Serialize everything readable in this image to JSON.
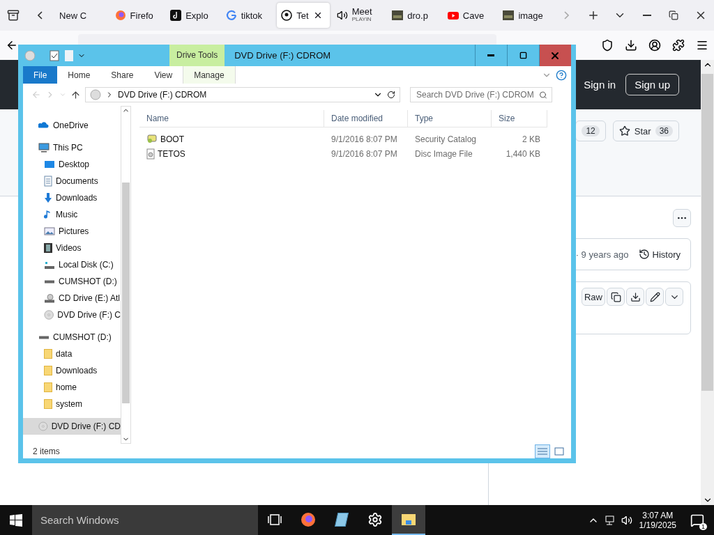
{
  "browser": {
    "tabs": [
      {
        "label": "New C",
        "kind": "none",
        "selected": false
      },
      {
        "label": "Firefo",
        "kind": "firefox",
        "selected": false
      },
      {
        "label": "Explo",
        "kind": "tiktok",
        "selected": false
      },
      {
        "label": "tiktok",
        "kind": "google",
        "selected": false
      },
      {
        "label": "Tet",
        "kind": "github",
        "selected": true
      },
      {
        "label": "Meet",
        "sublabel": "PLAYIN",
        "kind": "speaker",
        "selected": false
      },
      {
        "label": "dro.p",
        "kind": "thumb",
        "selected": false
      },
      {
        "label": "Cave",
        "kind": "youtube",
        "selected": false
      },
      {
        "label": "image",
        "kind": "thumb",
        "selected": false
      }
    ]
  },
  "page": {
    "sign_in": "Sign in",
    "sign_up": "Sign up",
    "fork_count": "12",
    "star_label": "Star",
    "star_count": "36",
    "commit_info": "· 9 years ago",
    "history": "History",
    "raw": "Raw"
  },
  "explorer": {
    "title": "DVD Drive (F:) CDROM",
    "context_tab": "Drive Tools",
    "ribbon_tabs": [
      {
        "label": "File",
        "kind": "file"
      },
      {
        "label": "Home",
        "kind": "tab"
      },
      {
        "label": "Share",
        "kind": "tab"
      },
      {
        "label": "View",
        "kind": "tab"
      },
      {
        "label": "Manage",
        "kind": "context"
      }
    ],
    "address": "DVD Drive (F:) CDROM",
    "search": {
      "placeholder": "Search DVD Drive (F:) CDROM"
    },
    "tree": [
      {
        "label": "OneDrive",
        "kind": "onedrive",
        "selected": false
      },
      {
        "label": "This PC",
        "kind": "pc",
        "selected": false,
        "children": [
          {
            "label": "Desktop",
            "kind": "desktop",
            "selected": false
          },
          {
            "label": "Documents",
            "kind": "documents",
            "selected": false
          },
          {
            "label": "Downloads",
            "kind": "downloads",
            "selected": false
          },
          {
            "label": "Music",
            "kind": "music",
            "selected": false
          },
          {
            "label": "Pictures",
            "kind": "pictures",
            "selected": false
          },
          {
            "label": "Videos",
            "kind": "videos",
            "selected": false
          },
          {
            "label": "Local Disk (C:)",
            "kind": "disk",
            "selected": false
          },
          {
            "label": "CUMSHOT (D:)",
            "kind": "drive",
            "selected": false
          },
          {
            "label": "CD Drive (E:) Atl",
            "kind": "cd",
            "selected": false
          },
          {
            "label": "DVD Drive (F:) C",
            "kind": "dvd",
            "selected": false
          }
        ]
      },
      {
        "label": "CUMSHOT (D:)",
        "kind": "drive",
        "selected": false,
        "children": [
          {
            "label": "data",
            "kind": "folder",
            "selected": false
          },
          {
            "label": "Downloads",
            "kind": "folder",
            "selected": false
          },
          {
            "label": "home",
            "kind": "folder",
            "selected": false
          },
          {
            "label": "system",
            "kind": "folder",
            "selected": false
          }
        ]
      },
      {
        "label": "DVD Drive (F:) CD",
        "kind": "dvd",
        "selected": true
      }
    ],
    "columns": [
      "Name",
      "Date modified",
      "Type",
      "Size"
    ],
    "rows": [
      {
        "name": "BOOT",
        "kind": "catalog",
        "date": "9/1/2016 8:07 PM",
        "type": "Security Catalog",
        "size": "2 KB",
        "selected": false
      },
      {
        "name": "TETOS",
        "kind": "disc",
        "date": "9/1/2016 8:07 PM",
        "type": "Disc Image File",
        "size": "1,440 KB",
        "selected": false
      }
    ],
    "status": "2 items",
    "views": [
      {
        "kind": "details",
        "selected": true
      },
      {
        "kind": "tiles",
        "selected": false
      }
    ]
  },
  "taskbar": {
    "search": {
      "placeholder": "Search Windows"
    },
    "apps": [
      {
        "kind": "taskview",
        "selected": false
      },
      {
        "kind": "firefox",
        "selected": false
      },
      {
        "kind": "notepad",
        "selected": false
      },
      {
        "kind": "settings",
        "selected": false
      },
      {
        "kind": "explorer",
        "selected": true
      }
    ],
    "time": "3:07 AM",
    "date": "1/19/2025",
    "notifications": "1"
  }
}
